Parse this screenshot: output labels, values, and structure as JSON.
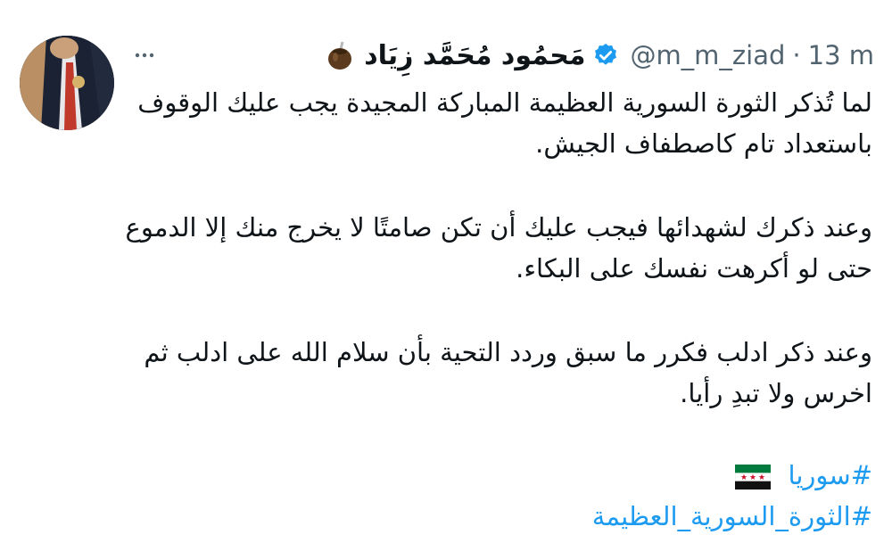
{
  "author": {
    "display_name": "مَحمُود مُحَمَّد زِيَاد",
    "handle": "@m_m_ziad",
    "separator": "·",
    "timestamp": "13 m",
    "verified": true,
    "name_emoji": "mate-gourd-icon",
    "avatar": "profile-photo"
  },
  "tweet": {
    "paragraphs": [
      "لما تُذكر الثورة السورية العظيمة المباركة المجيدة يجب عليك الوقوف باستعداد تام كاصطفاف الجيش.",
      "وعند ذكرك لشهدائها فيجب عليك أن تكن صامتًا لا يخرج منك إلا الدموع حتى لو أكرهت نفسك على البكاء.",
      "وعند ذكر ادلب فكرر ما سبق وردد التحية بأن سلام الله على ادلب ثم اخرس ولا تبدِ رأيا."
    ],
    "hashtags": [
      {
        "text": "#سوريا",
        "flag": "syrian-revolution-flag-icon"
      },
      {
        "text": "#الثورة_السورية_العظيمة",
        "flag": ""
      }
    ]
  },
  "colors": {
    "text": "#0f1419",
    "secondary": "#536471",
    "link": "#1d9bf0",
    "verified": "#1d9bf0"
  }
}
